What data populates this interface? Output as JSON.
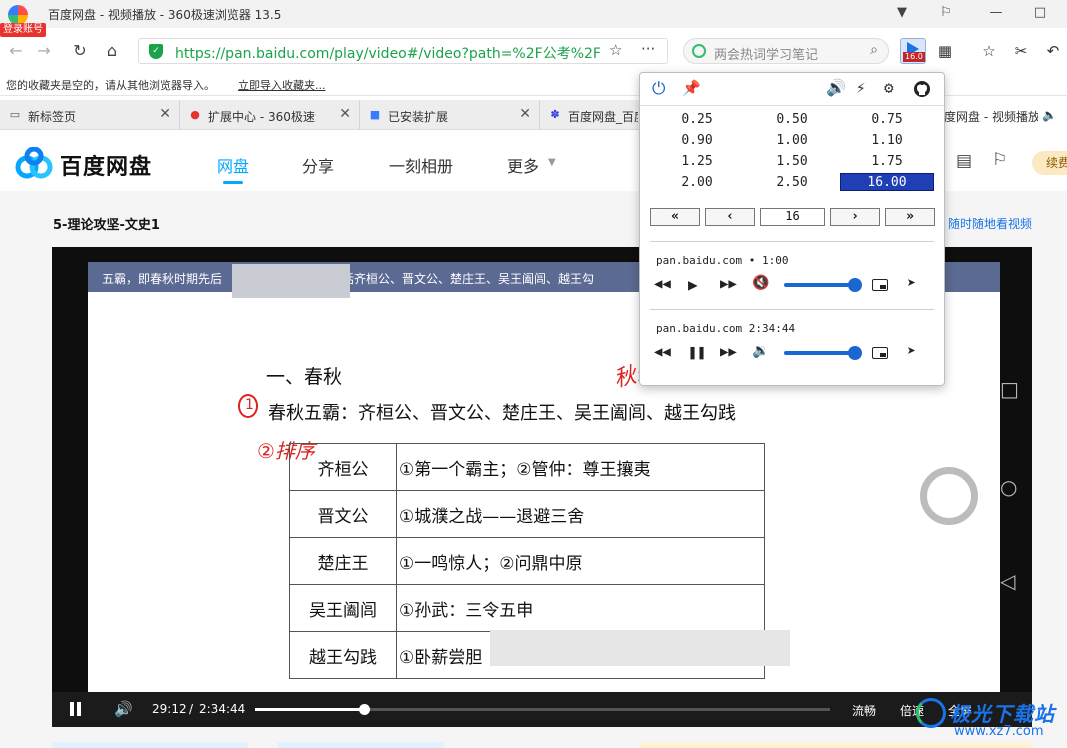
{
  "window": {
    "title": "百度网盘 - 视频播放 - 360极速浏览器 13.5",
    "login_badge": "登录账号",
    "controls": {
      "skin": "▼",
      "shirt": "⚐",
      "minimize": "—",
      "maximize": "□"
    }
  },
  "address_bar": {
    "url": "https://pan.baidu.com/play/video#/video?path=%2F公考%2F【(",
    "search_placeholder": "两会热词学习笔记",
    "ext_speed_badge": "16.0"
  },
  "bookmark_bar": {
    "empty_text": "您的收藏夹是空的，请从其他浏览器导入。",
    "import_link": "立即导入收藏夹..."
  },
  "tabs": [
    {
      "label": "新标签页",
      "icon": "▭"
    },
    {
      "label": "扩展中心 - 360极速浏",
      "icon": "●"
    },
    {
      "label": "已安装扩展",
      "icon": "■"
    },
    {
      "label": "百度网盘_百度",
      "icon": "✽"
    },
    {
      "label": "度网盘 - 视频播放",
      "icon": ""
    }
  ],
  "baidu": {
    "logo_text": "百度网盘",
    "nav": [
      "网盘",
      "分享",
      "一刻相册",
      "更多"
    ],
    "renew": "续费"
  },
  "video_page": {
    "title": "5-理论攻坚-文史1",
    "watch_anytime": "随时随地看视频"
  },
  "slide": {
    "top_strip": "五霸，即春秋时期先后",
    "top_strip_2": "括齐桓公、晋文公、楚庄王、吴王阖闾、越王勾",
    "top_strip_3": "吴王",
    "heading": "一、春秋",
    "line": "春秋五霸：齐桓公、晋文公、楚庄王、吴王阖闾、越王勾践",
    "circle_mark": "1",
    "note_1": "②排序",
    "note_2": "秋霸  尺   不提",
    "rows": [
      {
        "name": "齐桓公",
        "desc": "①第一个霸主；②管仲：尊王攘夷"
      },
      {
        "name": "晋文公",
        "desc": "①城濮之战——退避三舍"
      },
      {
        "name": "楚庄王",
        "desc": "①一鸣惊人；②问鼎中原"
      },
      {
        "name": "吴王阖闾",
        "desc": "①孙武：三令五申"
      },
      {
        "name": "越王勾践",
        "desc": "①卧薪尝胆"
      }
    ]
  },
  "player": {
    "current_time": "29:12",
    "separator": "/",
    "total_time": "2:34:44",
    "progress_fraction": 0.189,
    "quality": "流畅",
    "speed": "倍速",
    "fullscreen": "全屏"
  },
  "watermark": {
    "text": "极光下载站",
    "url": "www.xz7.com"
  },
  "speed_popup": {
    "speeds": [
      "0.25",
      "0.50",
      "0.75",
      "0.90",
      "1.00",
      "1.10",
      "1.25",
      "1.50",
      "1.75",
      "2.00",
      "2.50",
      "16.00"
    ],
    "active_speed": "16.00",
    "controls": {
      "slowest": "«",
      "slower": "‹",
      "value": "16",
      "faster": "›",
      "fastest": "»"
    },
    "media": [
      {
        "title": "pan.baidu.com • 1:00",
        "state": "paused",
        "muted": true,
        "volume": 1.0
      },
      {
        "title": "pan.baidu.com 2:34:44",
        "state": "playing",
        "muted": false,
        "volume": 1.0
      }
    ]
  }
}
